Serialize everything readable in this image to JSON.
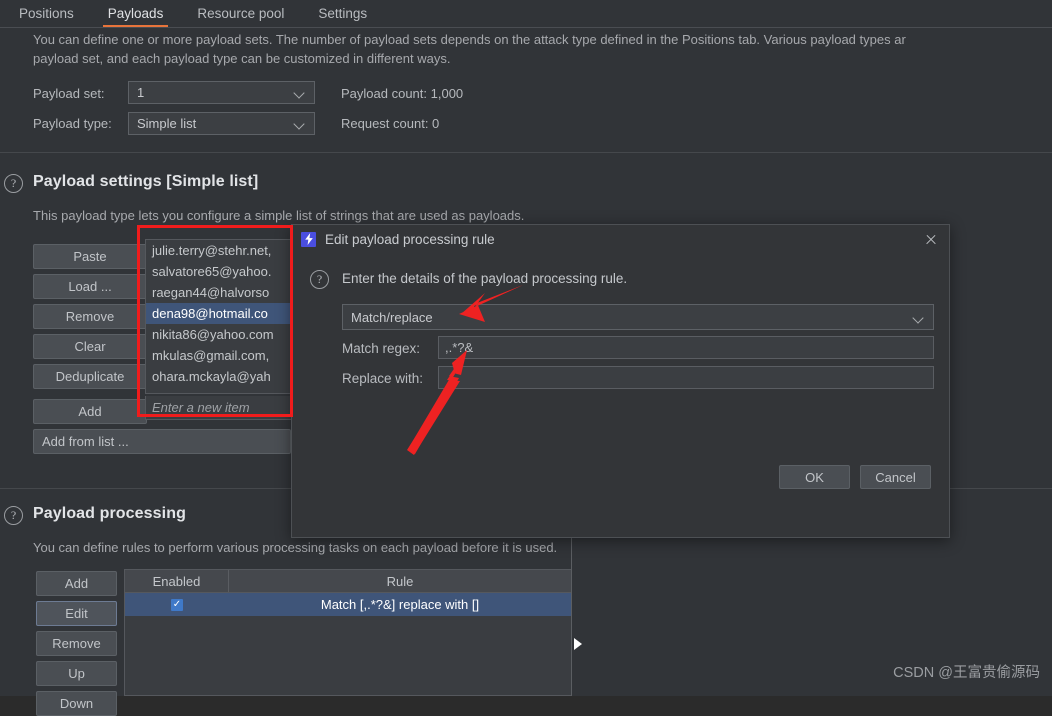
{
  "tabs": [
    {
      "label": "Positions",
      "active": false
    },
    {
      "label": "Payloads",
      "active": true
    },
    {
      "label": "Resource pool",
      "active": false
    },
    {
      "label": "Settings",
      "active": false
    }
  ],
  "payload_sets": {
    "description": "You can define one or more payload sets. The number of payload sets depends on the attack type defined in the Positions tab. Various payload types ar",
    "description_line2": "payload set, and each payload type can be customized in different ways.",
    "payload_set_label": "Payload set:",
    "payload_set_value": "1",
    "payload_type_label": "Payload type:",
    "payload_type_value": "Simple list",
    "payload_count": "Payload count: 1,000",
    "request_count": "Request count: 0"
  },
  "payload_settings": {
    "title": "Payload settings [Simple list]",
    "description": "This payload type lets you configure a simple list of strings that are used as payloads.",
    "buttons": [
      "Paste",
      "Load ...",
      "Remove",
      "Clear",
      "Deduplicate",
      "Add"
    ],
    "add_from_list": "Add from list ...",
    "items": [
      "julie.terry@stehr.net,",
      "salvatore65@yahoo.",
      "raegan44@halvorso",
      "dena98@hotmail.co",
      "nikita86@yahoo.com",
      "mkulas@gmail.com,",
      "ohara.mckayla@yah"
    ],
    "selected_index": 3,
    "new_item_placeholder": "Enter a new item"
  },
  "payload_processing": {
    "title": "Payload processing",
    "description": "You can define rules to perform various processing tasks on each payload before it is used.",
    "buttons": [
      "Add",
      "Edit",
      "Remove",
      "Up",
      "Down"
    ],
    "focused_button": "Edit",
    "columns": [
      "Enabled",
      "Rule"
    ],
    "rows": [
      {
        "enabled": true,
        "check": "✓",
        "rule": "Match [,.*?&] replace with []",
        "selected": true
      }
    ]
  },
  "dialog": {
    "icon": "bolt-icon",
    "title": "Edit payload processing rule",
    "close_icon": "close-icon",
    "help_icon": "help-icon",
    "instruction": "Enter the details of the payload processing rule.",
    "rule_type_value": "Match/replace",
    "match_regex_label": "Match regex:",
    "match_regex_value": ",.*?&",
    "replace_with_label": "Replace with:",
    "replace_with_value": "",
    "ok_label": "OK",
    "cancel_label": "Cancel"
  },
  "annotations": {
    "highlight_box_color": "#f01c1c",
    "arrow_color": "#ee2222"
  },
  "watermark": "CSDN @王富贵偷源码"
}
